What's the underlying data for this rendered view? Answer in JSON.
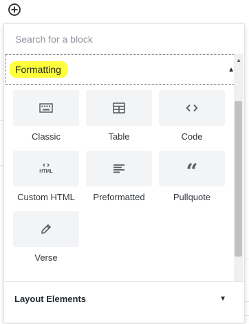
{
  "add_block_icon": "plus-circle-icon",
  "search": {
    "placeholder": "Search for a block"
  },
  "formatting_panel": {
    "title": "Formatting",
    "expanded": true,
    "highlight_color": "#ffff3b",
    "blocks": [
      {
        "label": "Classic",
        "icon": "keyboard-icon"
      },
      {
        "label": "Table",
        "icon": "table-icon"
      },
      {
        "label": "Code",
        "icon": "code-icon"
      },
      {
        "label": "Custom HTML",
        "icon": "html-icon",
        "icon_text": "HTML"
      },
      {
        "label": "Preformatted",
        "icon": "preformatted-icon"
      },
      {
        "label": "Pullquote",
        "icon": "quote-icon",
        "icon_text": "“"
      },
      {
        "label": "Verse",
        "icon": "pencil-icon"
      }
    ]
  },
  "layout_panel": {
    "title": "Layout Elements",
    "expanded": false
  }
}
